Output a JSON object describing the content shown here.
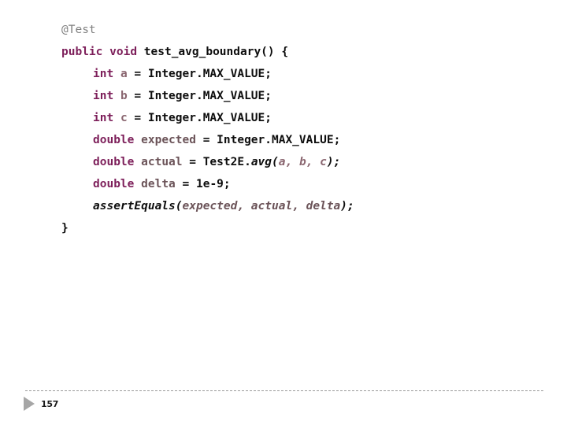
{
  "slide": {
    "page_number": "157",
    "background_color": "#ffffff",
    "nav_icon": "play-triangle-icon"
  },
  "colors": {
    "annotation": "#808080",
    "keyword": "#7d1f5a",
    "plain": "#0d0d0d",
    "variable": "#8a6670",
    "identifier": "#6b5358",
    "rule": "#9a9a9a",
    "nav_triangle": "#a6a6a6"
  },
  "code": {
    "language": "java",
    "lines": [
      {
        "indent": 0,
        "tokens": [
          {
            "text": "@Test",
            "type": "annotation"
          }
        ]
      },
      {
        "indent": 0,
        "tokens": [
          {
            "text": "public",
            "type": "keyword"
          },
          {
            "text": " ",
            "type": "plain"
          },
          {
            "text": "void",
            "type": "keyword"
          },
          {
            "text": " test_avg_boundary() {",
            "type": "plain"
          }
        ]
      },
      {
        "indent": 1,
        "tokens": [
          {
            "text": "int",
            "type": "keyword"
          },
          {
            "text": " ",
            "type": "plain"
          },
          {
            "text": "a",
            "type": "var"
          },
          {
            "text": " = Integer.MAX_VALUE;",
            "type": "plain"
          }
        ]
      },
      {
        "indent": 1,
        "tokens": [
          {
            "text": "int",
            "type": "keyword"
          },
          {
            "text": " ",
            "type": "plain"
          },
          {
            "text": "b",
            "type": "var"
          },
          {
            "text": " = Integer.MAX_VALUE;",
            "type": "plain"
          }
        ]
      },
      {
        "indent": 1,
        "tokens": [
          {
            "text": "int",
            "type": "keyword"
          },
          {
            "text": " ",
            "type": "plain"
          },
          {
            "text": "c",
            "type": "var"
          },
          {
            "text": " = Integer.MAX_VALUE;",
            "type": "plain"
          }
        ]
      },
      {
        "indent": 1,
        "tokens": [
          {
            "text": "double",
            "type": "keyword"
          },
          {
            "text": " ",
            "type": "plain"
          },
          {
            "text": "expected",
            "type": "ident"
          },
          {
            "text": " = Integer.MAX_VALUE;",
            "type": "plain"
          }
        ]
      },
      {
        "indent": 1,
        "tokens": [
          {
            "text": "double",
            "type": "keyword"
          },
          {
            "text": " ",
            "type": "plain"
          },
          {
            "text": "actual",
            "type": "ident"
          },
          {
            "text": " = Test2E.",
            "type": "plain"
          },
          {
            "text": "avg(",
            "type": "method-it"
          },
          {
            "text": "a, b, c",
            "type": "arg-it"
          },
          {
            "text": ");",
            "type": "method-it"
          }
        ]
      },
      {
        "indent": 1,
        "tokens": [
          {
            "text": "double",
            "type": "keyword"
          },
          {
            "text": " ",
            "type": "plain"
          },
          {
            "text": "delta",
            "type": "ident"
          },
          {
            "text": " = ",
            "type": "plain"
          },
          {
            "text": "1e-9;",
            "type": "number"
          }
        ]
      },
      {
        "indent": 1,
        "tokens": [
          {
            "text": "assertEquals(",
            "type": "assert"
          },
          {
            "text": "expected, actual, delta",
            "type": "assert-arg"
          },
          {
            "text": ");",
            "type": "assert"
          }
        ]
      },
      {
        "indent": 0,
        "tokens": [
          {
            "text": "}",
            "type": "brace"
          }
        ]
      }
    ]
  }
}
